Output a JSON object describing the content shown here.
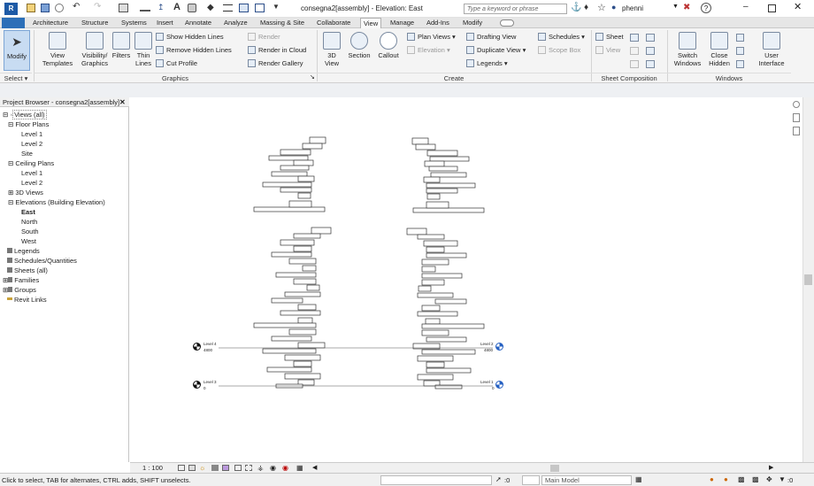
{
  "window": {
    "title": "consegna2[assembly] - Elevation: East",
    "search_placeholder": "Type a keyword or phrase",
    "user": "phenni"
  },
  "tabs": [
    {
      "label": "Architecture"
    },
    {
      "label": "Structure"
    },
    {
      "label": "Systems"
    },
    {
      "label": "Insert"
    },
    {
      "label": "Annotate"
    },
    {
      "label": "Analyze"
    },
    {
      "label": "Massing & Site"
    },
    {
      "label": "Collaborate"
    },
    {
      "label": "View"
    },
    {
      "label": "Manage"
    },
    {
      "label": "Add-Ins"
    },
    {
      "label": "Modify"
    }
  ],
  "ribbon": {
    "modify_label": "Modify",
    "select_panel": "Select",
    "graphics_panel": "Graphics",
    "create_panel": "Create",
    "sheet_panel": "Sheet Composition",
    "windows_panel": "Windows",
    "view_templates": "View Templates",
    "visibility_graphics": "Visibility/ Graphics",
    "filters": "Filters",
    "thin_lines": "Thin Lines",
    "show_hidden": "Show Hidden Lines",
    "remove_hidden": "Remove Hidden Lines",
    "cut_profile": "Cut Profile",
    "render": "Render",
    "render_cloud": "Render in Cloud",
    "render_gallery": "Render Gallery",
    "view_3d": "3D View",
    "section": "Section",
    "callout": "Callout",
    "plan_views": "Plan Views",
    "elevation": "Elevation",
    "drafting_view": "Drafting View",
    "duplicate_view": "Duplicate View",
    "legends": "Legends",
    "schedules": "Schedules",
    "scope_box": "Scope Box",
    "sheet": "Sheet",
    "view": "View",
    "switch_windows": "Switch Windows",
    "close_hidden": "Close Hidden",
    "user_interface": "User Interface"
  },
  "project_browser": {
    "title": "Project Browser - consegna2[assembly]",
    "items": [
      {
        "label": "Views (all)"
      },
      {
        "label": "Floor Plans"
      },
      {
        "label": "Level 1"
      },
      {
        "label": "Level 2"
      },
      {
        "label": "Site"
      },
      {
        "label": "Ceiling Plans"
      },
      {
        "label": "Level 1"
      },
      {
        "label": "Level 2"
      },
      {
        "label": "3D Views"
      },
      {
        "label": "Elevations (Building Elevation)"
      },
      {
        "label": "East"
      },
      {
        "label": "North"
      },
      {
        "label": "South"
      },
      {
        "label": "West"
      },
      {
        "label": "Legends"
      },
      {
        "label": "Schedules/Quantities"
      },
      {
        "label": "Sheets (all)"
      },
      {
        "label": "Families"
      },
      {
        "label": "Groups"
      },
      {
        "label": "Revit Links"
      }
    ]
  },
  "levels": {
    "level4_name": "Level 4",
    "level4_value": "4800",
    "level2_name": "Level 2",
    "level2_value": "4800",
    "level3_name": "Level 3",
    "level3_value": "0",
    "level1_name": "Level 1",
    "level1_value": "0"
  },
  "view_bar": {
    "scale": "1 : 100"
  },
  "status": {
    "text": "Click to select, TAB for alternates, CTRL adds, SHIFT unselects.",
    "zero_a": ":0",
    "zero_b": ":0",
    "model": "Main Model"
  }
}
